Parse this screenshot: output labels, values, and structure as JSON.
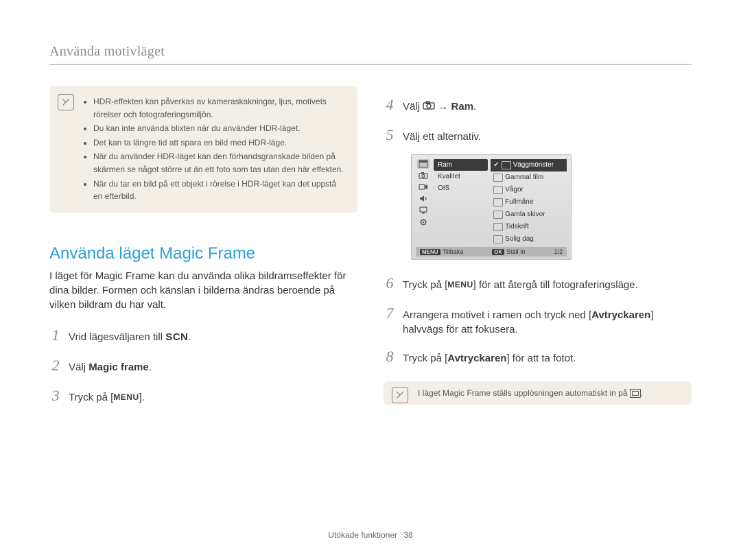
{
  "breadcrumb": "Använda motivläget",
  "note1": {
    "bullets": [
      "HDR-effekten kan påverkas av kameraskakningar, ljus, motivets rörelser och fotograferingsmiljön.",
      "Du kan inte använda blixten när du använder HDR-läget.",
      "Det kan ta längre tid att spara en bild med HDR-läge.",
      "När du använder HDR-läget kan den förhandsgranskade bilden på skärmen se något större ut än ett foto som tas utan den här effekten.",
      "När du tar en bild på ett objekt i rörelse i HDR-läget kan det uppstå en efterbild."
    ]
  },
  "section_title": "Använda läget Magic Frame",
  "intro": "I läget för Magic Frame kan du använda olika bildramseffekter för dina bilder. Formen och känslan i bilderna ändras beroende på vilken bildram du har valt.",
  "steps_left": [
    {
      "n": "1",
      "pre": "Vrid lägesväljaren till ",
      "glyph": "SCN",
      "post": "."
    },
    {
      "n": "2",
      "pre": "Välj ",
      "bold": "Magic frame",
      "post": "."
    },
    {
      "n": "3",
      "pre": "Tryck på [",
      "glyph": "MENU",
      "post": "]."
    }
  ],
  "steps_right_top": [
    {
      "n": "4",
      "pre": "Välj ",
      "glyph": "CAM",
      "mid": " → ",
      "bold": "Ram",
      "post": "."
    },
    {
      "n": "5",
      "text": "Välj ett alternativ."
    }
  ],
  "screen": {
    "menu": [
      {
        "label": "Ram",
        "selected": true
      },
      {
        "label": "Kvalitet"
      },
      {
        "label": "OIS"
      }
    ],
    "options": [
      {
        "label": "Väggmönster",
        "selected": true,
        "checked": true
      },
      {
        "label": "Gammal film"
      },
      {
        "label": "Vågor"
      },
      {
        "label": "Fullmåne"
      },
      {
        "label": "Gamla skivor"
      },
      {
        "label": "Tidskrift"
      },
      {
        "label": "Solig dag"
      }
    ],
    "footer": {
      "back_key": "MENU",
      "back": "Tillbaka",
      "set_key": "OK",
      "set": "Ställ In",
      "page": "1/2"
    }
  },
  "steps_right_bottom": [
    {
      "n": "6",
      "pre": "Tryck på [",
      "glyph": "MENU",
      "post": "] för att återgå till fotograferingsläge."
    },
    {
      "n": "7",
      "pre": "Arrangera motivet i ramen och tryck ned [",
      "bold": "Avtryckaren",
      "post": "] halvvägs för att fokusera."
    },
    {
      "n": "8",
      "pre": "Tryck på [",
      "bold": "Avtryckaren",
      "post": "] för att ta fotot."
    }
  ],
  "note2": "I läget Magic Frame ställs upplösningen automatiskt in på ",
  "footer": {
    "label": "Utökade funktioner",
    "page": "38"
  }
}
